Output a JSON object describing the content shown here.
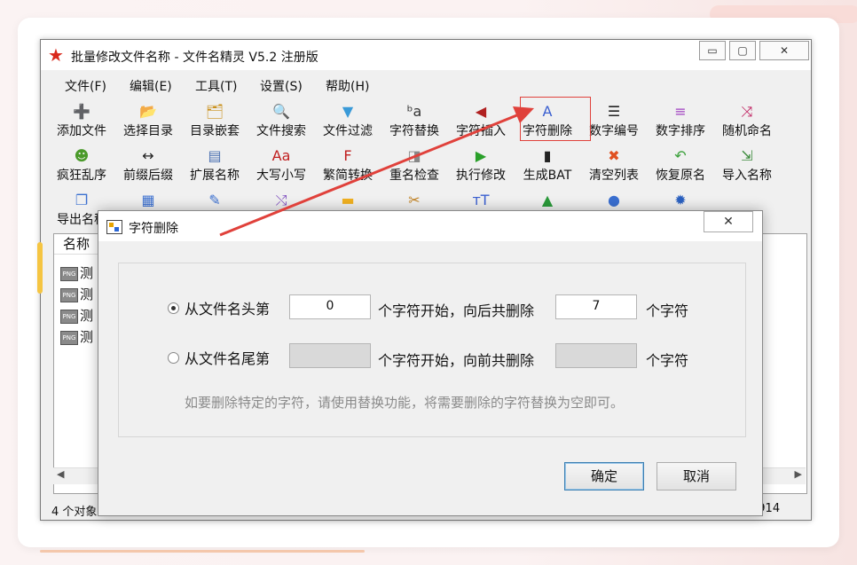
{
  "window": {
    "title": "批量修改文件名称 - 文件名精灵 V5.2 注册版",
    "controls": {
      "minimize": "▭",
      "maximize": "▢",
      "close": "✕"
    }
  },
  "menu": [
    "文件(F)",
    "编辑(E)",
    "工具(T)",
    "设置(S)",
    "帮助(H)"
  ],
  "toolbar": {
    "row1": [
      {
        "label": "添加文件",
        "icon": "add-file-icon",
        "glyph": "➕",
        "color": "#3a8a3a"
      },
      {
        "label": "选择目录",
        "icon": "folder-icon",
        "glyph": "📂",
        "color": "#d89a1c"
      },
      {
        "label": "目录嵌套",
        "icon": "nested-folder-icon",
        "glyph": "🗂",
        "color": "#c9901c"
      },
      {
        "label": "文件搜索",
        "icon": "search-icon",
        "glyph": "🔍",
        "color": "#3a6fd0"
      },
      {
        "label": "文件过滤",
        "icon": "filter-icon",
        "glyph": "▼",
        "color": "#3a9ad8"
      },
      {
        "label": "字符替换",
        "icon": "replace-icon",
        "glyph": "ᵇa",
        "color": "#333333"
      },
      {
        "label": "字符插入",
        "icon": "insert-icon",
        "glyph": "◀",
        "color": "#b02020"
      },
      {
        "label": "字符删除",
        "icon": "delete-char-icon",
        "glyph": "A",
        "color": "#3a5fd0"
      },
      {
        "label": "数字编号",
        "icon": "numbered-list-icon",
        "glyph": "☰",
        "color": "#222222"
      },
      {
        "label": "数字排序",
        "icon": "sort-icon",
        "glyph": "≡",
        "color": "#a040c0"
      },
      {
        "label": "随机命名",
        "icon": "shuffle-icon",
        "glyph": "⤨",
        "color": "#c02060"
      }
    ],
    "row2": [
      {
        "label": "疯狂乱序",
        "icon": "crazy-icon",
        "glyph": "☻",
        "color": "#4a9a2a"
      },
      {
        "label": "前缀后缀",
        "icon": "prefix-suffix-icon",
        "glyph": "↔",
        "color": "#222222"
      },
      {
        "label": "扩展名称",
        "icon": "extension-icon",
        "glyph": "▤",
        "color": "#4a70b0"
      },
      {
        "label": "大写小写",
        "icon": "case-icon",
        "glyph": "Aa",
        "color": "#c02020"
      },
      {
        "label": "繁简转换",
        "icon": "traditional-simplified-icon",
        "glyph": "F",
        "color": "#c02020"
      },
      {
        "label": "重名检查",
        "icon": "duplicate-check-icon",
        "glyph": "◨",
        "color": "#888888"
      },
      {
        "label": "执行修改",
        "icon": "play-icon",
        "glyph": "▶",
        "color": "#2aa02a"
      },
      {
        "label": "生成BAT",
        "icon": "terminal-icon",
        "glyph": "▮",
        "color": "#222222"
      },
      {
        "label": "清空列表",
        "icon": "clear-list-icon",
        "glyph": "✖",
        "color": "#e05020"
      },
      {
        "label": "恢复原名",
        "icon": "undo-icon",
        "glyph": "↶",
        "color": "#3aa03a"
      },
      {
        "label": "导入名称",
        "icon": "import-icon",
        "glyph": "⇲",
        "color": "#3a8a3a"
      }
    ],
    "row3": [
      {
        "label": "导出名称",
        "icon": "export-icon",
        "glyph": "❐",
        "color": "#3a6fd0"
      },
      {
        "label": "",
        "icon": "grid-icon",
        "glyph": "▦",
        "color": "#3a6fd0"
      },
      {
        "label": "",
        "icon": "edit-icon",
        "glyph": "✎",
        "color": "#3a6fd0"
      },
      {
        "label": "",
        "icon": "cross-arrows-icon",
        "glyph": "⤭",
        "color": "#8050c0"
      },
      {
        "label": "",
        "icon": "yellow-folder-icon",
        "glyph": "▬",
        "color": "#f0b020"
      },
      {
        "label": "",
        "icon": "tools-icon",
        "glyph": "✂",
        "color": "#c08020"
      },
      {
        "label": "",
        "icon": "font-size-icon",
        "glyph": "тT",
        "color": "#3a5fd0"
      },
      {
        "label": "",
        "icon": "drive-icon",
        "glyph": "▲",
        "color": "#2a9a3a"
      },
      {
        "label": "",
        "icon": "bell-icon",
        "glyph": "●",
        "color": "#3a6fd0"
      },
      {
        "label": "",
        "icon": "settings-gear-icon",
        "glyph": "✹",
        "color": "#2a60c0"
      }
    ]
  },
  "filelist": {
    "header": "名称",
    "items": [
      "测",
      "测",
      "测",
      "测"
    ],
    "badge": "PNG"
  },
  "status": {
    "left": "4 个对象",
    "right": "9914"
  },
  "dialog": {
    "title": "字符删除",
    "close": "✕",
    "option1": {
      "prefix": "从文件名头第",
      "start_value": "0",
      "middle": "个字符开始，向后共删除",
      "count_value": "7",
      "suffix": "个字符",
      "selected": true
    },
    "option2": {
      "prefix": "从文件名尾第",
      "start_value": "",
      "middle": "个字符开始，向前共删除",
      "count_value": "",
      "suffix": "个字符",
      "selected": false
    },
    "hint": "如要删除特定的字符，请使用替换功能，将需要删除的字符替换为空即可。",
    "ok": "确定",
    "cancel": "取消"
  },
  "colors": {
    "highlight": "#e0413b",
    "arrow": "#e0413b"
  }
}
